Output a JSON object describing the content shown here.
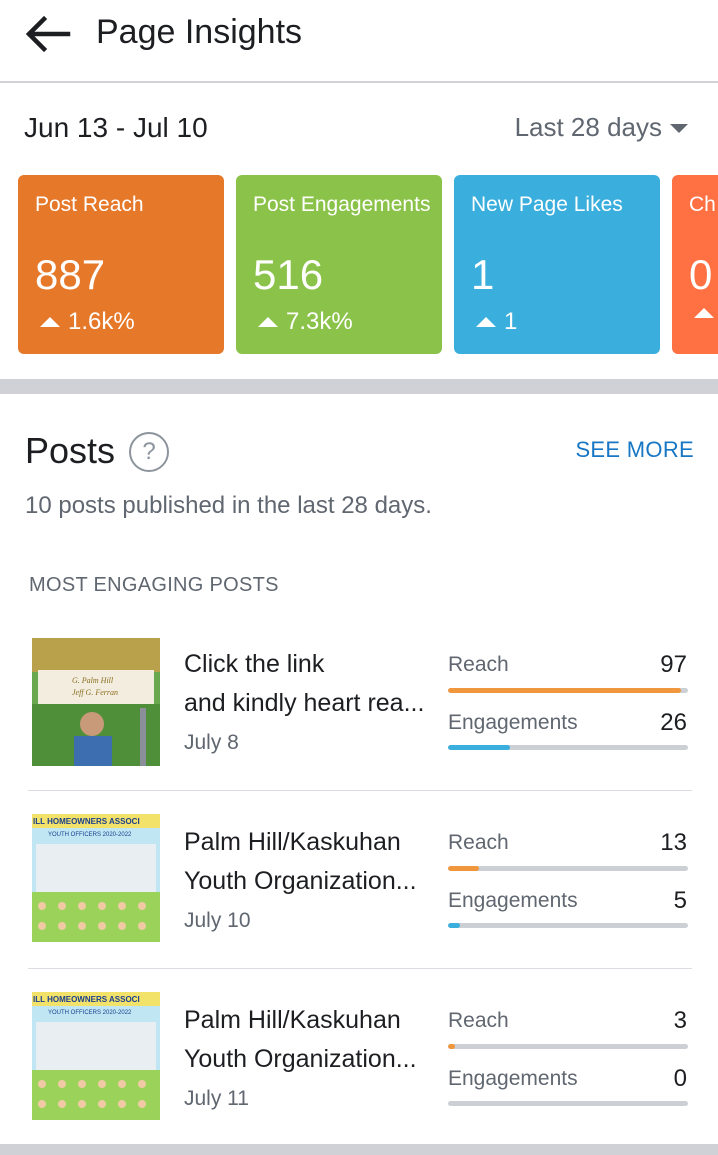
{
  "header": {
    "title": "Page Insights"
  },
  "date_range": "Jun 13 - Jul 10",
  "period_select": "Last 28 days",
  "cards": [
    {
      "label": "Post Reach",
      "value": "887",
      "delta": "1.6k%",
      "color": "#e6782a"
    },
    {
      "label": "Post Engagements",
      "value": "516",
      "delta": "7.3k%",
      "color": "#8bc34a"
    },
    {
      "label": "New Page Likes",
      "value": "1",
      "delta": "1",
      "color": "#3aaedc"
    },
    {
      "label": "Ch",
      "value": "0",
      "delta": "",
      "color": "#ff7043"
    }
  ],
  "posts_section": {
    "heading": "Posts",
    "help_icon": "?",
    "see_more": "SEE MORE",
    "summary": "10 posts published in the last 28 days.",
    "subheading": "MOST ENGAGING POSTS"
  },
  "metric_labels": {
    "reach": "Reach",
    "engagements": "Engagements"
  },
  "colors": {
    "reach_bar": "#f0963c",
    "engagement_bar": "#3aaedc",
    "link": "#1877c4"
  },
  "posts": [
    {
      "title": "Click the link and kindly heart rea...",
      "line1": "Click the link",
      "line2": "and kindly heart rea...",
      "date": "July 8",
      "reach": "97",
      "engagements": "26",
      "reach_fill": 0.97,
      "eng_fill": 0.26,
      "thumb_text1": "G. Palm Hill",
      "thumb_text2": "Jeff G. Ferran"
    },
    {
      "title": "Palm Hill/Kaskuhan Youth Organization...",
      "line1": "Palm Hill/Kaskuhan",
      "line2": "Youth Organization...",
      "date": "July 10",
      "reach": "13",
      "engagements": "5",
      "reach_fill": 0.13,
      "eng_fill": 0.05,
      "thumb_text1": "ILL HOMEOWNERS ASSOCI",
      "thumb_text2": "YOUTH OFFICERS 2020-2022"
    },
    {
      "title": "Palm Hill/Kaskuhan Youth Organization...",
      "line1": "Palm Hill/Kaskuhan",
      "line2": "Youth Organization...",
      "date": "July 11",
      "reach": "3",
      "engagements": "0",
      "reach_fill": 0.03,
      "eng_fill": 0.0,
      "thumb_text1": "ILL HOMEOWNERS ASSOCI",
      "thumb_text2": "YOUTH OFFICERS 2020-2022"
    }
  ]
}
